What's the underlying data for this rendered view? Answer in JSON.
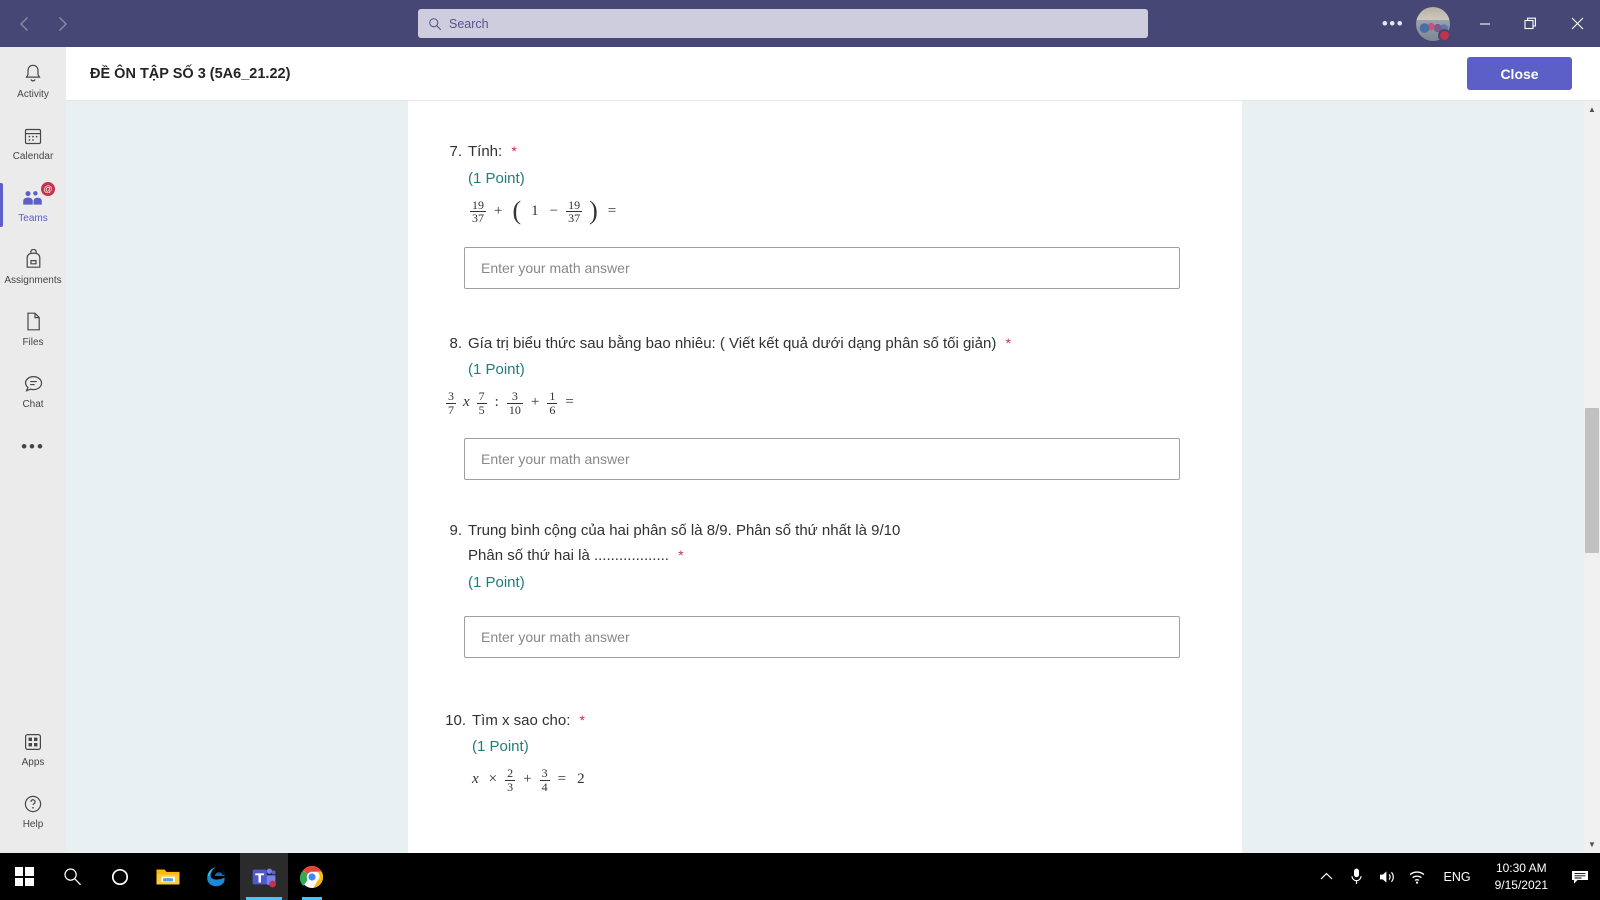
{
  "titlebar": {
    "back_icon": "chevron-left-icon",
    "forward_icon": "chevron-right-icon",
    "search_placeholder": "Search",
    "more_label": "•••",
    "minimize_label": "Minimize",
    "maximize_label": "Restore",
    "close_label": "Close",
    "accent_color": "#464775",
    "status_color": "#c4314b"
  },
  "rail": {
    "items": [
      {
        "label": "Activity",
        "icon": "bell-icon",
        "active": false
      },
      {
        "label": "Calendar",
        "icon": "calendar-icon",
        "active": false
      },
      {
        "label": "Teams",
        "icon": "teams-icon",
        "active": true,
        "badge": "@"
      },
      {
        "label": "Assignments",
        "icon": "backpack-icon",
        "active": false
      },
      {
        "label": "Files",
        "icon": "file-icon",
        "active": false
      },
      {
        "label": "Chat",
        "icon": "chat-icon",
        "active": false
      }
    ],
    "more_label": "•••",
    "bottom": [
      {
        "label": "Apps",
        "icon": "apps-grid-icon"
      },
      {
        "label": "Help",
        "icon": "question-circle-icon"
      }
    ],
    "active_color": "#5b5fc7"
  },
  "form": {
    "title": "ĐỀ ÔN TẬP SỐ 3 (5A6_21.22)",
    "close_button": "Close",
    "answer_placeholder": "Enter your math answer",
    "points_label": "(1 Point)",
    "required_mark": "*",
    "questions": [
      {
        "number": "7.",
        "text": "Tính:",
        "points": "(1 Point)",
        "formula": "19/37 + ( 1 − 19/37 ) =",
        "formula_parts": {
          "f1_num": "19",
          "f1_den": "37",
          "op1": "+",
          "lparen": "(",
          "one": "1",
          "op2": "−",
          "f2_num": "19",
          "f2_den": "37",
          "rparen": ")",
          "equals": "="
        },
        "has_input": true
      },
      {
        "number": "8.",
        "text": "Gía trị biểu thức sau bằng bao nhiêu: ( Viết kết quả dưới dạng phân số tối giản)",
        "points": "(1 Point)",
        "formula": "3/7 x 7/5 : 3/10 + 1/6 =",
        "formula_parts": {
          "f1_num": "3",
          "f1_den": "7",
          "op1": "x",
          "f2_num": "7",
          "f2_den": "5",
          "op2": ":",
          "f3_num": "3",
          "f3_den": "10",
          "op3": "+",
          "f4_num": "1",
          "f4_den": "6",
          "equals": "="
        },
        "has_input": true
      },
      {
        "number": "9.",
        "text": "Trung bình cộng của hai  phân số là 8/9. Phân số thứ nhất là 9/10",
        "text_line2": "Phân số thứ hai là ..................",
        "points": "(1 Point)",
        "has_input": true
      },
      {
        "number": "10.",
        "text": "Tìm x  sao cho:",
        "points": "(1 Point)",
        "formula": "x × 2/3 + 3/4 = 2",
        "formula_parts": {
          "var": "x",
          "op1": "×",
          "f1_num": "2",
          "f1_den": "3",
          "op2": "+",
          "f2_num": "3",
          "f2_den": "4",
          "equals": "=",
          "result": "2"
        },
        "has_input": false
      }
    ]
  },
  "scrollbar": {
    "up_arrow": "▲",
    "down_arrow": "▼"
  },
  "taskbar": {
    "items": [
      {
        "name": "start-button",
        "icon": "windows-logo-icon"
      },
      {
        "name": "search-button",
        "icon": "magnifier-icon"
      },
      {
        "name": "cortana-button",
        "icon": "circle-icon"
      },
      {
        "name": "file-explorer-button",
        "icon": "folder-icon"
      },
      {
        "name": "edge-button",
        "icon": "edge-icon"
      },
      {
        "name": "teams-button",
        "icon": "teams-icon"
      },
      {
        "name": "chrome-button",
        "icon": "chrome-icon"
      }
    ],
    "tray": {
      "chevron": "⌃",
      "mic_icon": "microphone-icon",
      "volume_icon": "speaker-icon",
      "network_icon": "wifi-icon",
      "language": "ENG",
      "time": "10:30 AM",
      "date": "9/15/2021",
      "notification_icon": "message-icon"
    }
  }
}
